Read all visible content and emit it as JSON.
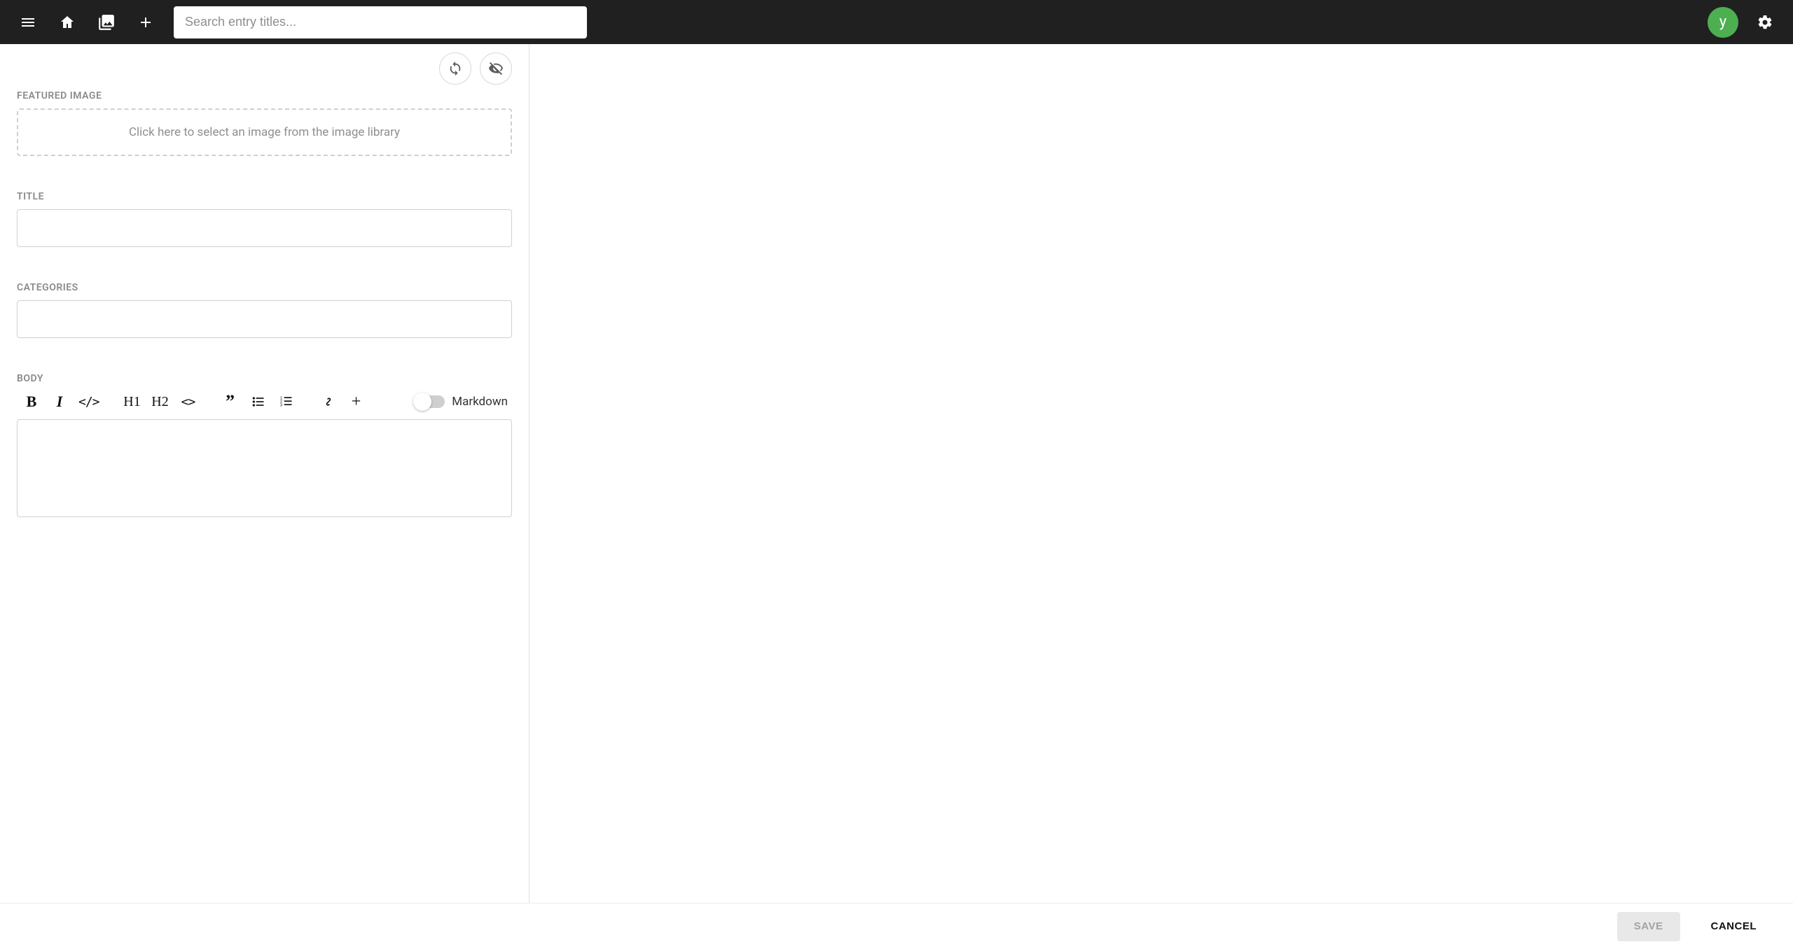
{
  "topbar": {
    "search_placeholder": "Search entry titles...",
    "avatar_letter": "y"
  },
  "editor": {
    "featured_image_label": "FEATURED IMAGE",
    "featured_image_placeholder": "Click here to select an image from the image library",
    "title_label": "TITLE",
    "categories_label": "CATEGORIES",
    "body_label": "BODY",
    "markdown_label": "Markdown",
    "toolbar": {
      "bold": "B",
      "italic": "I",
      "inline_code": "</>",
      "h1": "H1",
      "h2": "H2",
      "code_block": "<>",
      "quote": "”",
      "plus": "+"
    }
  },
  "footer": {
    "save": "Save",
    "cancel": "Cancel"
  }
}
